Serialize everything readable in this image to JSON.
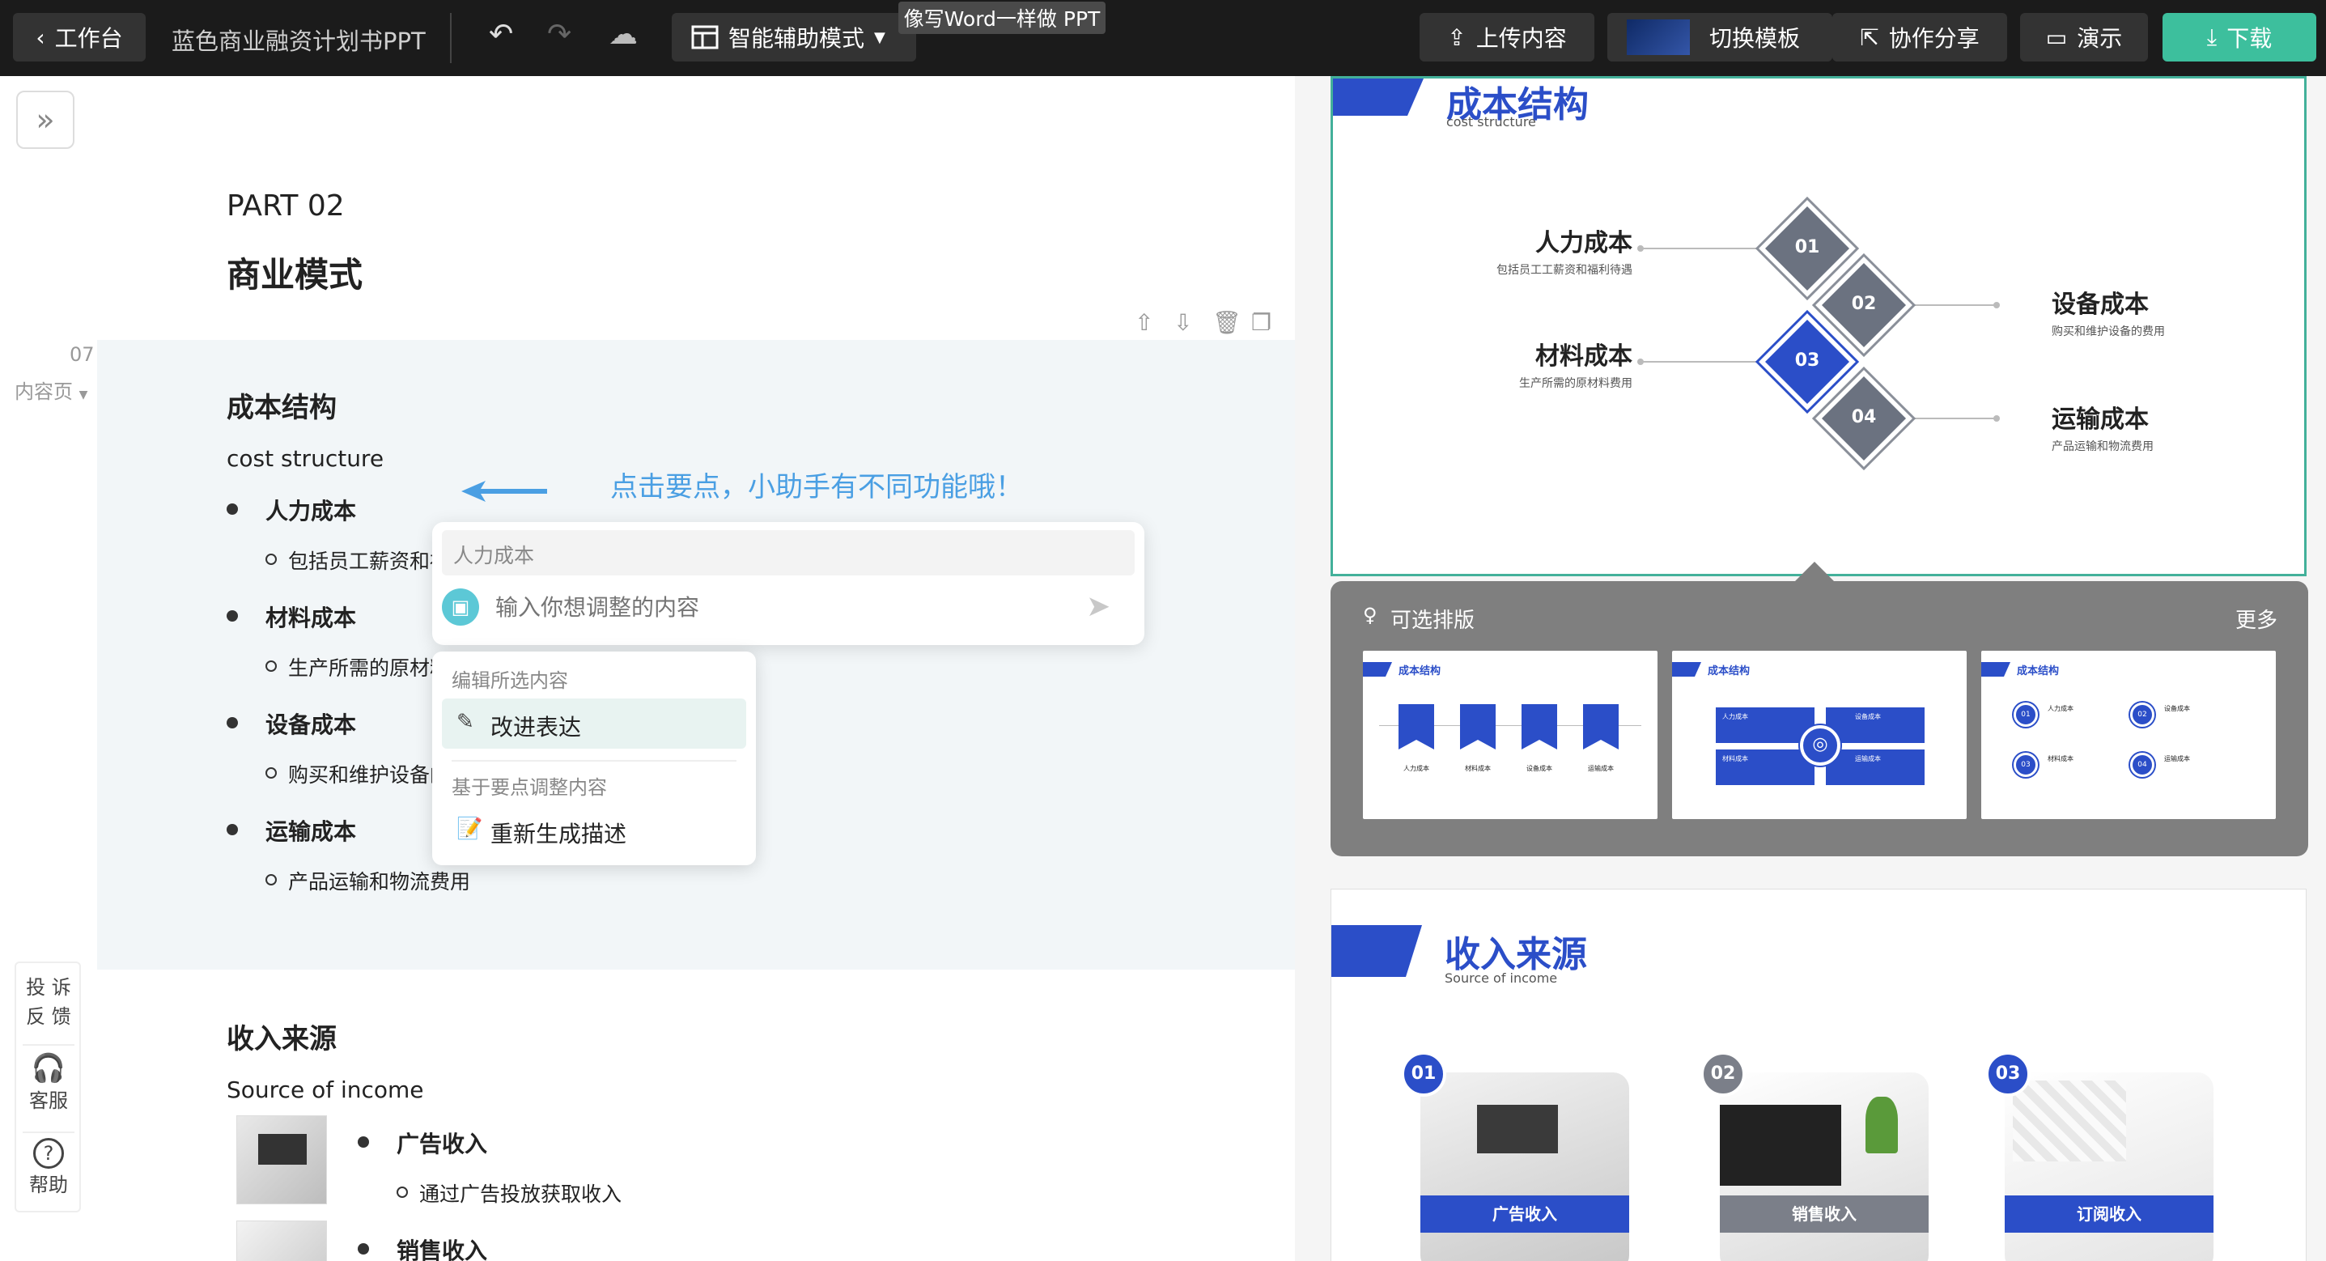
{
  "topbar": {
    "back_label": "工作台",
    "doc_title": "蓝色商业融资计划书PPT",
    "mode_label": "智能辅助模式",
    "tooltip": "像写Word一样做 PPT",
    "upload_label": "上传内容",
    "template_label": "切换模板",
    "share_label": "协作分享",
    "present_label": "演示",
    "download_label": "下载"
  },
  "editor": {
    "part_label": "PART 02",
    "section_title": "商业模式",
    "page_number": "07",
    "page_type": "内容页",
    "slide_title": "成本结构",
    "slide_subtitle": "cost structure",
    "hint": "点击要点，小助手有不同功能哦！",
    "points": [
      {
        "title": "人力成本",
        "desc": "包括员工薪资和福"
      },
      {
        "title": "材料成本",
        "desc": "生产所需的原材料"
      },
      {
        "title": "设备成本",
        "desc": "购买和维护设备的"
      },
      {
        "title": "运输成本",
        "desc": "产品运输和物流费用"
      }
    ],
    "next_title": "收入来源",
    "next_subtitle": "Source of income",
    "next_points": [
      {
        "title": "广告收入",
        "desc": "通过广告投放获取收入"
      },
      {
        "title": "销售收入"
      }
    ]
  },
  "ai_popup": {
    "selected": "人力成本",
    "placeholder": "输入你想调整的内容",
    "menu": {
      "group1": "编辑所选内容",
      "item1": "改进表达",
      "group2": "基于要点调整内容",
      "item2": "重新生成描述"
    }
  },
  "left_tools": {
    "feedback_1": "投 诉",
    "feedback_2": "反 馈",
    "support": "客服",
    "help": "帮助"
  },
  "preview": {
    "slide1": {
      "title": "成本结构",
      "subtitle": "cost structure",
      "items": [
        {
          "num": "01",
          "title": "人力成本",
          "desc": "包括员工工薪资和福利待遇"
        },
        {
          "num": "02",
          "title": "设备成本",
          "desc": "购买和维护设备的费用"
        },
        {
          "num": "03",
          "title": "材料成本",
          "desc": "生产所需的原材料费用"
        },
        {
          "num": "04",
          "title": "运输成本",
          "desc": "产品运输和物流费用"
        }
      ]
    },
    "layouts_label": "可选排版",
    "more_label": "更多",
    "thumb_title": "成本结构",
    "thumb1_labels": [
      "人力成本",
      "材料成本",
      "设备成本",
      "运输成本"
    ],
    "thumb2_labels": [
      "人力成本",
      "设备成本",
      "材料成本",
      "运输成本"
    ],
    "thumb3_labels": [
      "人力成本",
      "设备成本",
      "材料成本",
      "运输成本"
    ],
    "thumb3_nums": [
      "01",
      "02",
      "03",
      "04"
    ],
    "slide2": {
      "title": "收入来源",
      "subtitle": "Source of income",
      "cards": [
        {
          "num": "01",
          "label": "广告收入"
        },
        {
          "num": "02",
          "label": "销售收入"
        },
        {
          "num": "03",
          "label": "订阅收入"
        }
      ]
    }
  }
}
